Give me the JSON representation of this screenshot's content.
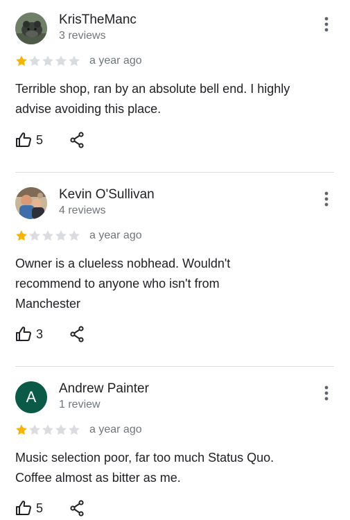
{
  "colors": {
    "star_filled": "#f4b400",
    "star_empty": "#dadce0",
    "secondary_text": "#70757a",
    "avatar_letter_bg": "#0b5a48"
  },
  "reviews": [
    {
      "author": "KrisTheManc",
      "review_count": "3 reviews",
      "rating": 1,
      "max_rating": 5,
      "date": "a year ago",
      "text": "Terrible shop, ran by an absolute bell end. I highly advise avoiding this place.",
      "likes": "5",
      "avatar": "photo"
    },
    {
      "author": "Kevin O'Sullivan",
      "review_count": "4 reviews",
      "rating": 1,
      "max_rating": 5,
      "date": "a year ago",
      "text": "Owner is a clueless nobhead. Wouldn't recommend to anyone who isn't from Manchester",
      "likes": "3",
      "avatar": "photo"
    },
    {
      "author": "Andrew Painter",
      "review_count": "1 review",
      "rating": 1,
      "max_rating": 5,
      "date": "a year ago",
      "text": "Music selection poor, far too much Status Quo. Coffee almost as bitter as me.",
      "likes": "5",
      "avatar": "A"
    }
  ],
  "icons": {
    "like": "thumbs-up-icon",
    "share": "share-icon",
    "more": "more-vert-icon",
    "star": "star-icon"
  }
}
